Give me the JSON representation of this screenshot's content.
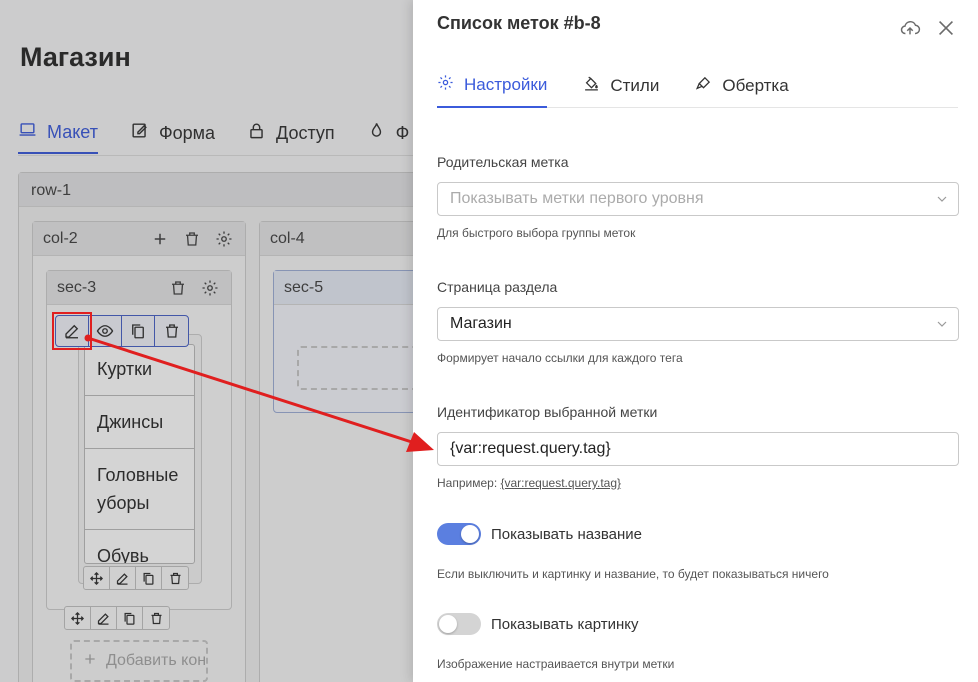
{
  "builder": {
    "page_title": "Магазин",
    "tabs": [
      {
        "label": "Макет",
        "icon": "laptop-icon",
        "active": true
      },
      {
        "label": "Форма",
        "icon": "edit-form-icon",
        "active": false
      },
      {
        "label": "Доступ",
        "icon": "lock-icon",
        "active": false
      },
      {
        "label": "Ф",
        "icon": "flame-icon",
        "active": false
      }
    ],
    "row_label": "row-1",
    "col2_label": "col-2",
    "col4_label": "col-4",
    "sec3_label": "sec-3",
    "sec5_label": "sec-5",
    "tag_items": [
      "Куртки",
      "Джинсы",
      "Головные уборы",
      "Обувь"
    ],
    "add_component_label": "Добавить кон"
  },
  "panel": {
    "title": "Список меток #b-8",
    "tabs": [
      {
        "label": "Настройки",
        "icon": "gear-icon",
        "active": true
      },
      {
        "label": "Стили",
        "icon": "paint-bucket-icon",
        "active": false
      },
      {
        "label": "Обертка",
        "icon": "brush-icon",
        "active": false
      }
    ],
    "parent_tag": {
      "label": "Родительская метка",
      "placeholder": "Показывать метки первого уровня",
      "help": "Для быстрого выбора группы меток"
    },
    "section_page": {
      "label": "Страница раздела",
      "value": "Магазин",
      "help": "Формирует начало ссылки для каждого тега"
    },
    "selected_tag_id": {
      "label": "Идентификатор выбранной метки",
      "value": "{var:request.query.tag}",
      "help_prefix": "Например:",
      "help_example": "{var:request.query.tag}"
    },
    "show_name": {
      "label": "Показывать название",
      "on": true,
      "help": "Если выключить и картинку и название, то будет показываться ничего"
    },
    "show_image": {
      "label": "Показывать картинку",
      "on": false,
      "help": "Изображение настраивается внутри метки"
    }
  },
  "colors": {
    "accent": "#3b5bdb",
    "toggle_on": "#5b7fe0",
    "annotation_red": "#e01f1f"
  }
}
